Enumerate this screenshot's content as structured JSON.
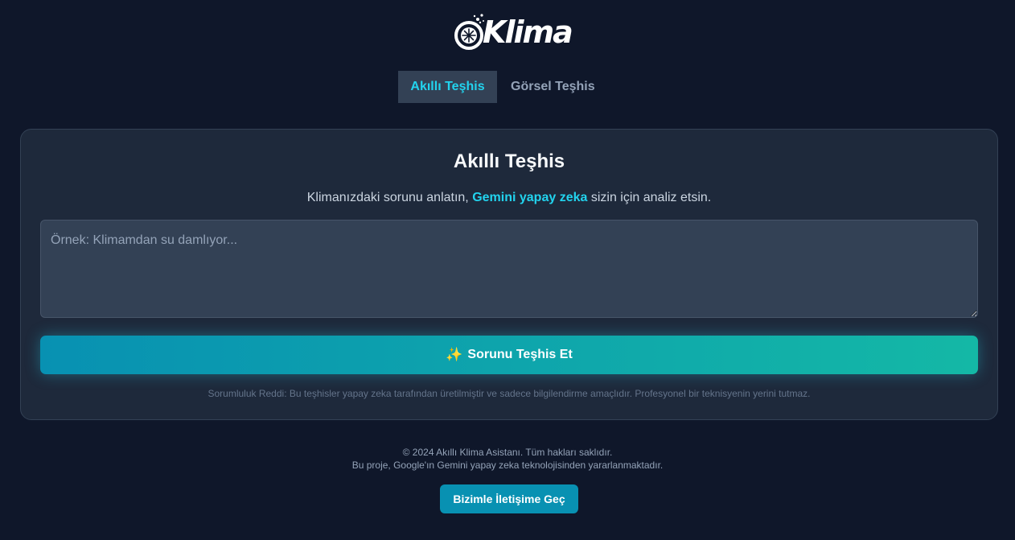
{
  "header": {
    "logo_text": "Klima",
    "logo_icon": "snowflake-fan-icon"
  },
  "tabs": [
    {
      "label": "Akıllı Teşhis",
      "active": true
    },
    {
      "label": "Görsel Teşhis",
      "active": false
    }
  ],
  "card": {
    "title": "Akıllı Teşhis",
    "subtitle_before": "Klimanızdaki sorunu anlatın, ",
    "subtitle_highlight": "Gemini yapay zeka",
    "subtitle_after": " sizin için analiz etsin.",
    "textarea_placeholder": "Örnek: Klimamdan su damlıyor...",
    "textarea_value": "",
    "button_icon": "sparkles-icon",
    "button_label": "Sorunu Teşhis Et",
    "disclaimer": "Sorumluluk Reddi: Bu teşhisler yapay zeka tarafından üretilmiştir ve sadece bilgilendirme amaçlıdır. Profesyonel bir teknisyenin yerini tutmaz."
  },
  "footer": {
    "copyright": "© 2024 Akıllı Klima Asistanı. Tüm hakları saklıdır.",
    "note": "Bu proje, Google'ın Gemini yapay zeka teknolojisinden yararlanmaktadır.",
    "contact_label": "Bizimle İletişime Geç"
  },
  "colors": {
    "background": "#0f172a",
    "card": "#1e293b",
    "accent": "#22d3ee",
    "button_gradient_start": "#0891b2",
    "button_gradient_end": "#14b8a6"
  }
}
